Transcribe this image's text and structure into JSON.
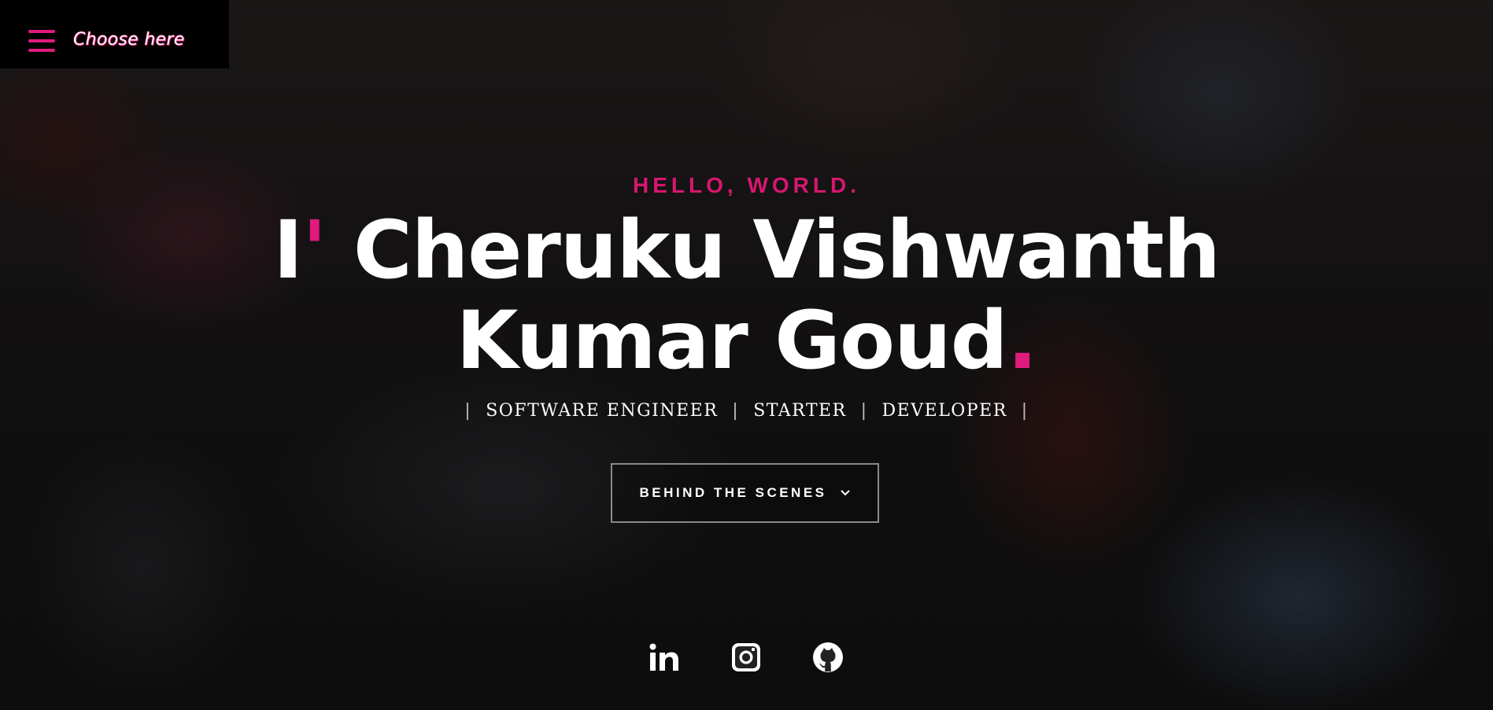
{
  "menu": {
    "label": "Choose here",
    "icon": "hamburger-menu-icon",
    "accent_color": "#e01b7d"
  },
  "hero": {
    "greeting": "HELLO, WORLD.",
    "name_prefix": "I",
    "name_apostrophe": "'",
    "name_line1_rest": " Cheruku Vishwanth",
    "name_line2": "Kumar Goud",
    "name_end_dot": ".",
    "roles": [
      "SOFTWARE ENGINEER",
      "STARTER",
      "DEVELOPER"
    ],
    "role_separator": "|",
    "cta_label": "BEHIND THE SCENES",
    "cta_icon": "chevron-down-icon",
    "accent_color": "#e01b7d",
    "greeting_color": "#d6176f"
  },
  "socials": [
    {
      "name": "linkedin",
      "icon": "linkedin-icon"
    },
    {
      "name": "instagram",
      "icon": "instagram-icon"
    },
    {
      "name": "github",
      "icon": "github-icon"
    }
  ]
}
